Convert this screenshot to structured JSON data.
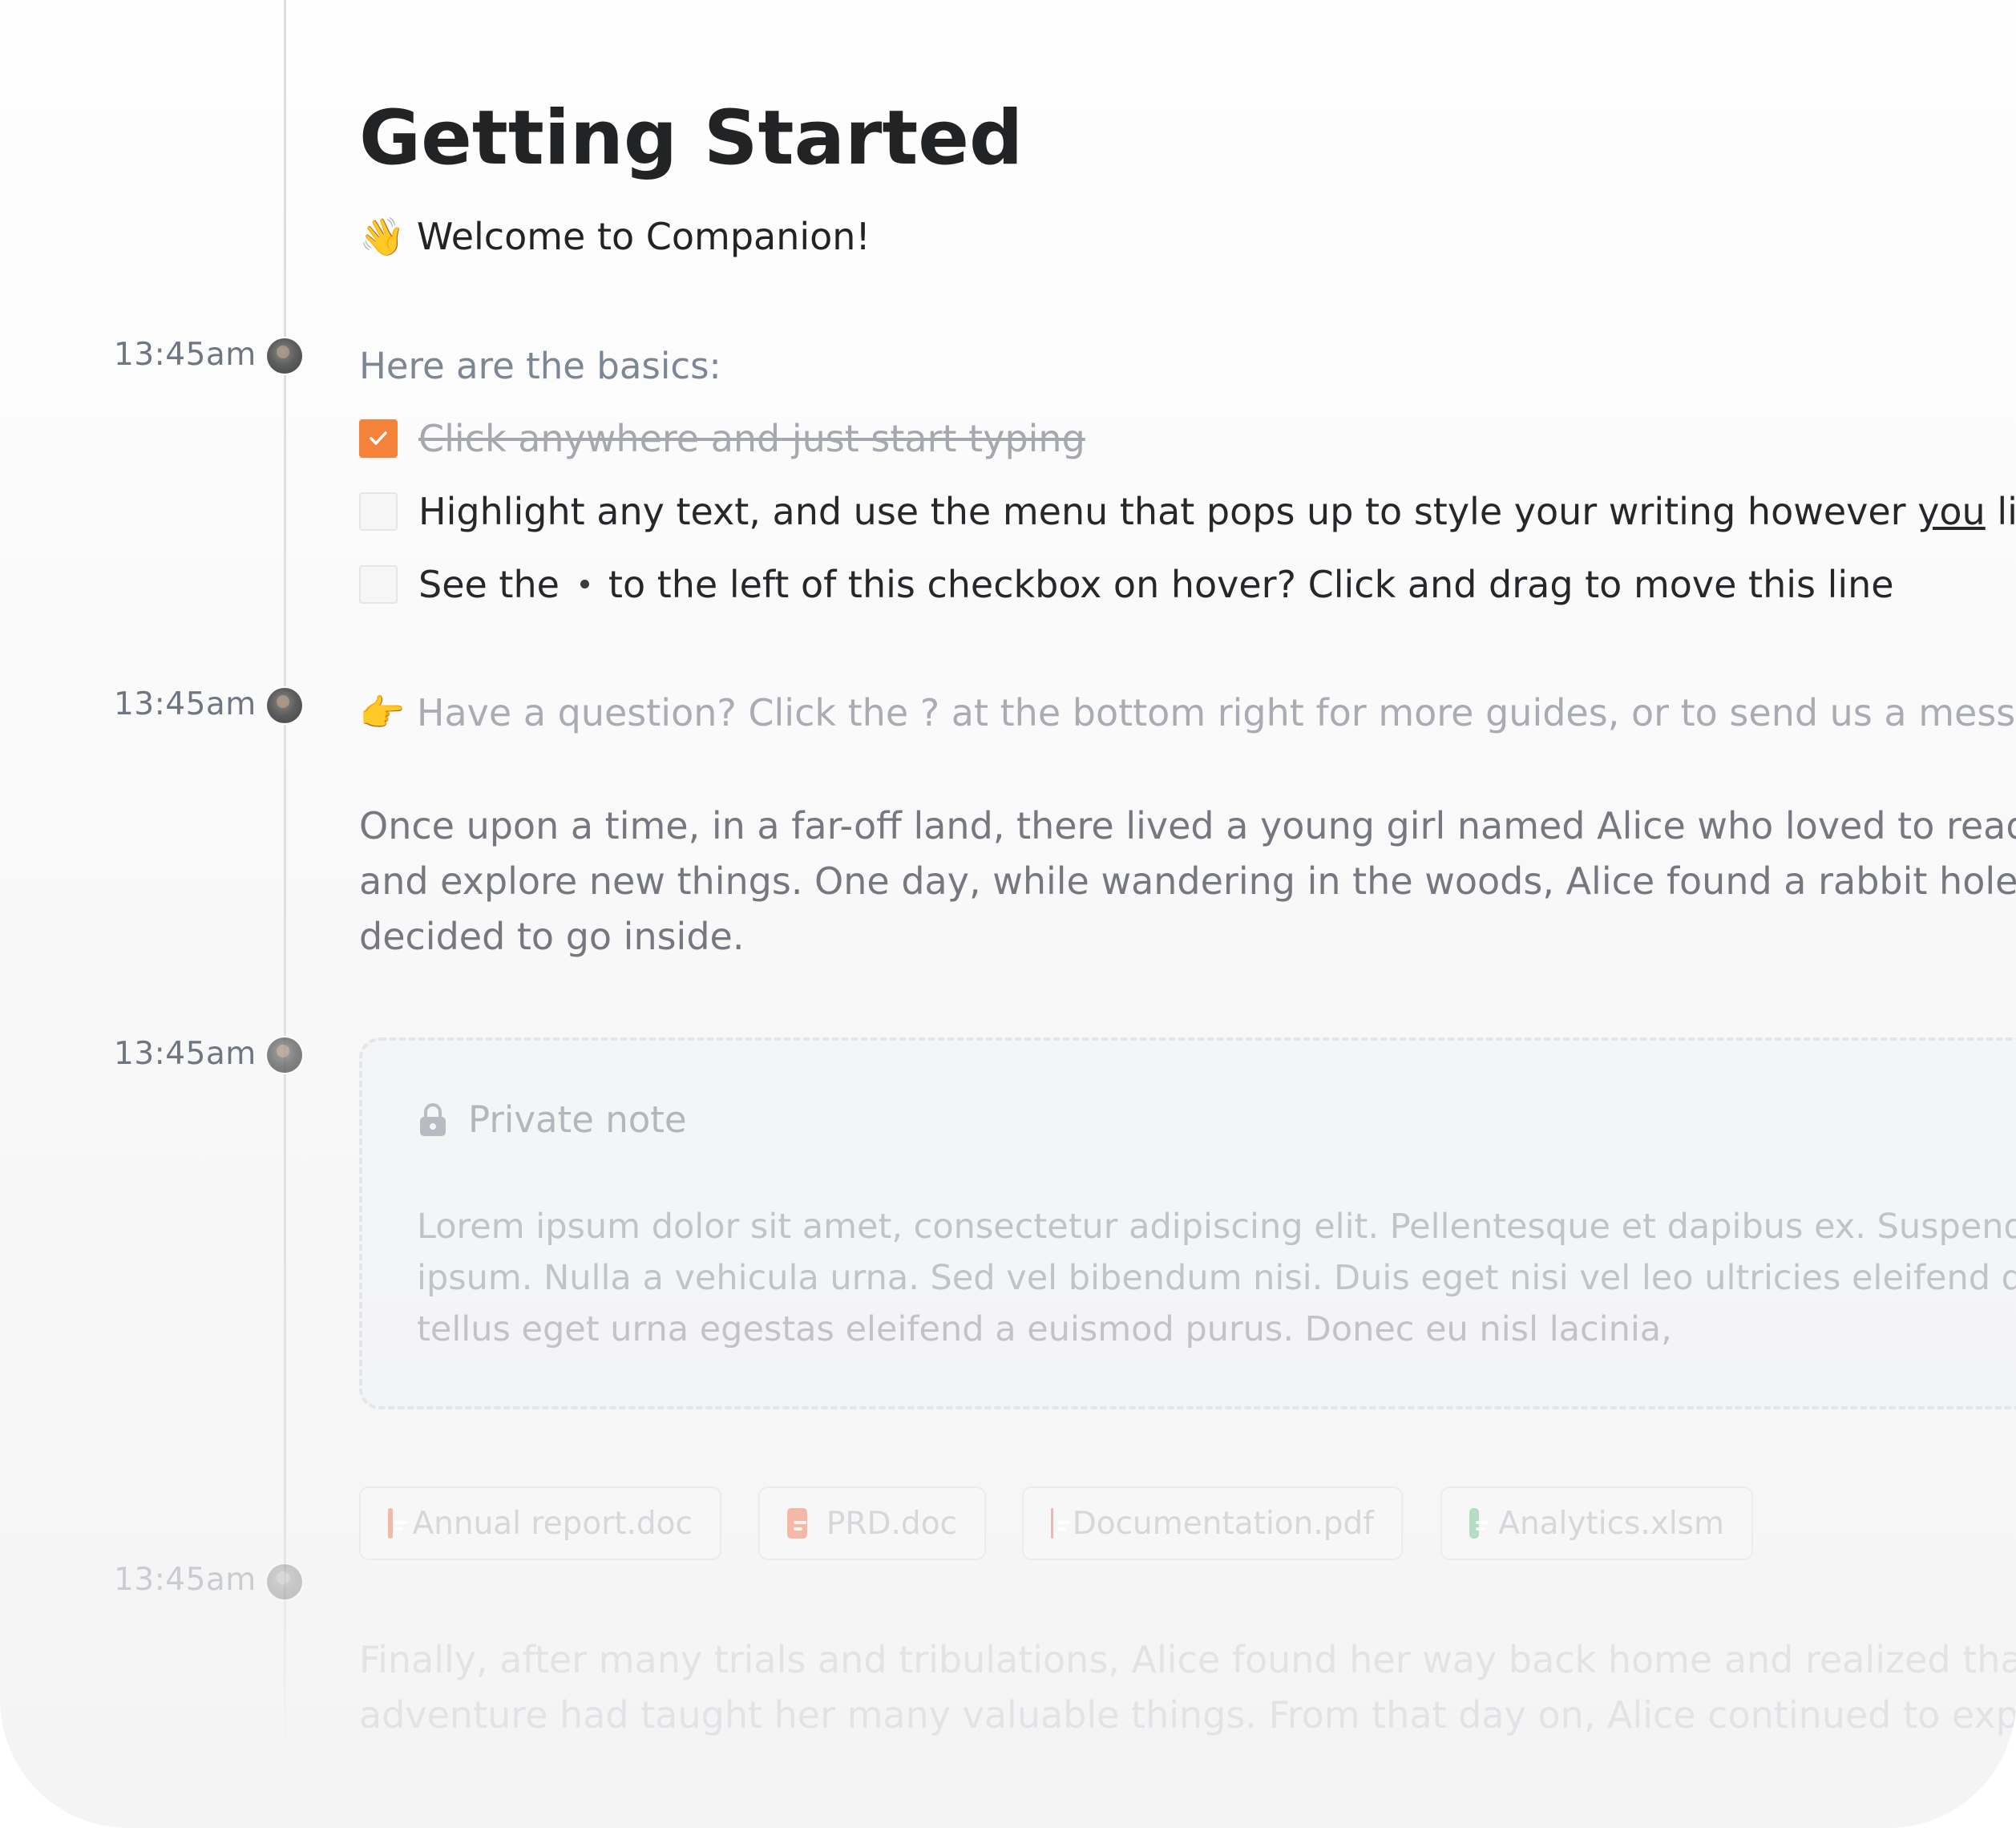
{
  "title": "Getting Started",
  "welcome": {
    "emoji": "👋",
    "text": "Welcome to Companion!"
  },
  "timestamps": [
    "13:45am",
    "13:45am",
    "13:45am",
    "13:45am"
  ],
  "basics_heading": "Here are the basics:",
  "todos": [
    {
      "text": "Click anywhere and just start typing",
      "checked": true
    },
    {
      "text_before": "Highlight any text, and use the menu that pops up to style your writing however ",
      "underlined": "you",
      "text_after": " like",
      "checked": false
    },
    {
      "text_before": "See the",
      "text_after": "to the left of this checkbox on hover? Click and drag to move this line",
      "checked": false
    }
  ],
  "question": {
    "emoji": "👉",
    "text": "Have a question? Click the ? at the bottom right for more guides, or to send us a messag"
  },
  "story": {
    "lines": [
      "Once upon a time, in a far-off land, there lived a young girl named Alice who loved to read",
      "and explore new things. One day, while wandering in the woods, Alice found a rabbit hole a",
      "decided to go inside."
    ]
  },
  "private_note": {
    "label": "Private note",
    "icon": "lock-icon",
    "lines": [
      "Lorem ipsum dolor sit amet, consectetur adipiscing elit. Pellentesque et dapibus ex. Suspend",
      "ipsum. Nulla a vehicula urna. Sed vel bibendum nisi. Duis eget nisi vel leo ultricies eleifend qu",
      "tellus eget urna egestas eleifend a euismod purus. Donec eu nisl lacinia,"
    ]
  },
  "attachments": [
    {
      "name": "Annual report.doc",
      "color": "#f4b8a6"
    },
    {
      "name": "PRD.doc",
      "color": "#f4b8a6"
    },
    {
      "name": "Documentation.pdf",
      "color": "#f2b5b5"
    },
    {
      "name": "Analytics.xlsm",
      "color": "#b6dcc3"
    }
  ],
  "finally": {
    "lines": [
      "Finally, after many trials and tribulations, Alice found her way back home and realized that",
      "adventure had taught her many valuable things. From that day on, Alice continued to expl"
    ]
  },
  "colors": {
    "accent": "#f4823a",
    "text": "#222324",
    "muted": "#7d8694"
  }
}
